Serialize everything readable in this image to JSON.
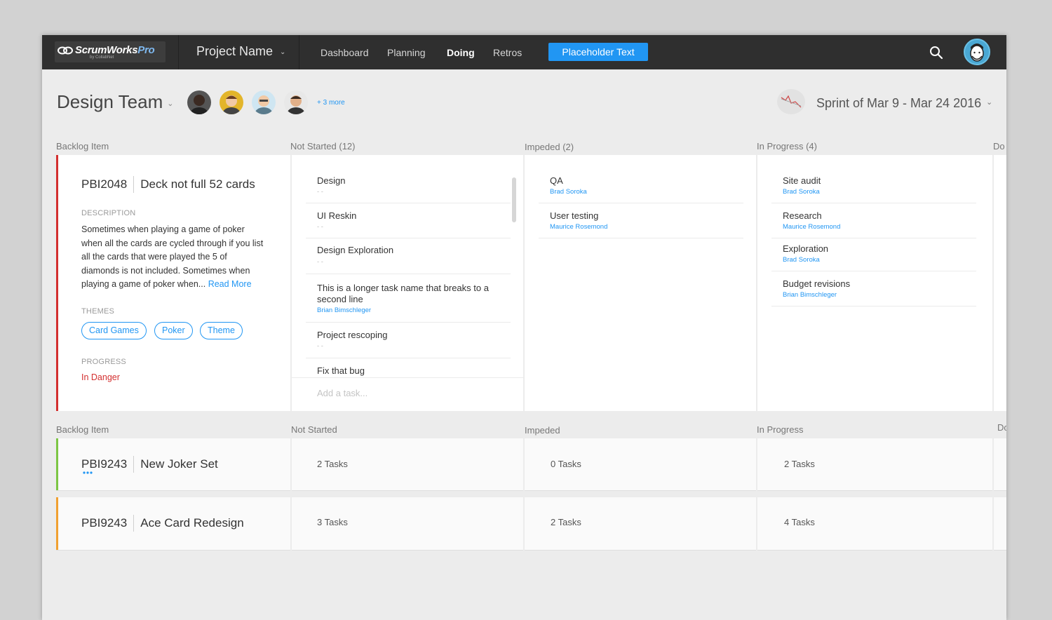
{
  "brand": {
    "name": "ScrumWorks",
    "suffix": "Pro",
    "tagline": "by CollabNet"
  },
  "project": {
    "name": "Project Name"
  },
  "nav": [
    "Dashboard",
    "Planning",
    "Doing",
    "Retros"
  ],
  "nav_active": "Doing",
  "cta": "Placeholder Text",
  "team": {
    "title": "Design Team",
    "more": "+ 3 more"
  },
  "sprint": {
    "label": "Sprint of Mar 9 - Mar 24 2016"
  },
  "columns_top": [
    "Backlog Item",
    "Not Started (12)",
    "Impeded (2)",
    "In Progress (4)",
    "Do"
  ],
  "columns_bottom": [
    "Backlog Item",
    "Not Started",
    "Impeded",
    "In Progress",
    "Do"
  ],
  "selected_pbi": {
    "id": "PBI2048",
    "title": "Deck not full 52 cards",
    "description_label": "DESCRIPTION",
    "description": "Sometimes when playing a game of poker when all the cards are cycled through if you list all the cards that were played the 5 of diamonds is not included. Sometimes when playing a game of poker when...",
    "read_more": "Read More",
    "themes_label": "THEMES",
    "themes": [
      "Card Games",
      "Poker",
      "Theme"
    ],
    "progress_label": "PROGRESS",
    "progress": "In Danger",
    "stripe_color": "#d32f2f"
  },
  "not_started_tasks": [
    {
      "name": "Design",
      "assignee": "- -"
    },
    {
      "name": "UI Reskin",
      "assignee": "- -"
    },
    {
      "name": "Design Exploration",
      "assignee": "- -"
    },
    {
      "name": "This is a longer task name that breaks to a second line",
      "assignee": "Brian Bimschleger"
    },
    {
      "name": "Project rescoping",
      "assignee": "- -"
    },
    {
      "name": "Fix that bug",
      "assignee": ""
    }
  ],
  "add_task_placeholder": "Add a task...",
  "impeded_tasks": [
    {
      "name": "QA",
      "assignee": "Brad Soroka"
    },
    {
      "name": "User testing",
      "assignee": "Maurice Rosemond"
    }
  ],
  "in_progress_tasks": [
    {
      "name": "Site audit",
      "assignee": "Brad Soroka"
    },
    {
      "name": "Research",
      "assignee": "Maurice Rosemond"
    },
    {
      "name": "Exploration",
      "assignee": "Brad Soroka"
    },
    {
      "name": "Budget revisions",
      "assignee": "Brian Bimschleger"
    }
  ],
  "collapsed_items": [
    {
      "id": "PBI9243",
      "title": "New Joker Set",
      "not_started": "2 Tasks",
      "impeded": "0 Tasks",
      "in_progress": "2 Tasks",
      "stripe_color": "#7cc544"
    },
    {
      "id": "PBI9243",
      "title": "Ace Card Redesign",
      "not_started": "3 Tasks",
      "impeded": "2 Tasks",
      "in_progress": "4 Tasks",
      "stripe_color": "#f0a030"
    }
  ],
  "colors": {
    "topbar": "#2f2f2f",
    "accent": "#2196f3",
    "danger": "#d32f2f",
    "background": "#ececec"
  }
}
